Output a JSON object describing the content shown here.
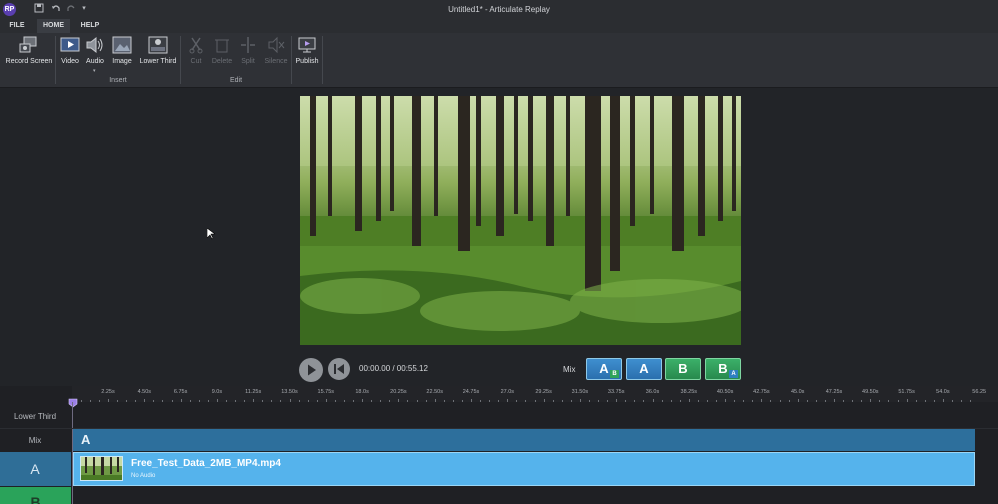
{
  "app": {
    "logo_text": "RP",
    "title": "Untitled1* - Articulate Replay"
  },
  "quick_access": [
    {
      "name": "save-icon",
      "glyph": "💾"
    },
    {
      "name": "undo-icon",
      "glyph": "↶"
    },
    {
      "name": "redo-icon",
      "glyph": "↷"
    },
    {
      "name": "customize-dropdown-icon",
      "glyph": "▾"
    }
  ],
  "tabs": [
    "FILE",
    "HOME",
    "HELP"
  ],
  "ribbon": {
    "record_screen": "Record Screen",
    "insert": {
      "video": "Video",
      "audio": "Audio",
      "image": "Image",
      "lower_third": "Lower Third",
      "group": "Insert"
    },
    "edit": {
      "cut": "Cut",
      "delete": "Delete",
      "split": "Split",
      "silence": "Silence",
      "group": "Edit"
    },
    "publish": "Publish"
  },
  "player": {
    "timecode": "00:00.00 / 00:55.12",
    "mix_label": "Mix"
  },
  "mix_buttons": [
    {
      "label": "A",
      "sub": "B",
      "style": "blue"
    },
    {
      "label": "A",
      "sub": "",
      "style": "blue"
    },
    {
      "label": "B",
      "sub": "",
      "style": "green"
    },
    {
      "label": "B",
      "sub": "A",
      "style": "green"
    }
  ],
  "timeline": {
    "ticks": [
      "2.25s",
      "4.50s",
      "6.75s",
      "9.0s",
      "11.25s",
      "13.50s",
      "15.75s",
      "18.0s",
      "20.25s",
      "22.50s",
      "24.75s",
      "27.0s",
      "29.25s",
      "31.50s",
      "33.75s",
      "36.0s",
      "38.25s",
      "40.50s",
      "42.75s",
      "45.0s",
      "47.25s",
      "49.50s",
      "51.75s",
      "54.0s",
      "56.25"
    ],
    "tracks": {
      "lower_third": "Lower Third",
      "mix": "Mix",
      "a": "A",
      "b": "B"
    },
    "mix_track_label": "A",
    "clip": {
      "name": "Free_Test_Data_2MB_MP4.mp4",
      "audio": "No Audio"
    }
  },
  "colors": {
    "accent_blue": "#55b3ec",
    "mix_blue": "#2d6f9c",
    "track_a": "#2f6e97",
    "track_b": "#2aa35a"
  }
}
